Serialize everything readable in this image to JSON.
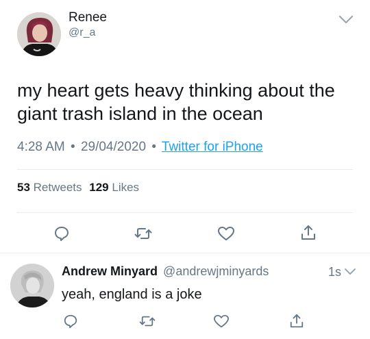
{
  "tweet": {
    "author": {
      "name": "Renee",
      "handle": "@r_a"
    },
    "text": "my heart gets heavy thinking about the giant trash island in the ocean",
    "time": "4:28 AM",
    "date": "29/04/2020",
    "source": "Twitter for iPhone",
    "separator": "•",
    "stats": {
      "retweets_count": "53",
      "retweets_label": "Retweets",
      "likes_count": "129",
      "likes_label": "Likes"
    }
  },
  "reply": {
    "author": {
      "name": "Andrew Minyard",
      "handle": "@andrewjminyards"
    },
    "age": "1s",
    "text": "yeah, england is a joke"
  },
  "icons": {
    "reply": "reply-icon",
    "retweet": "retweet-icon",
    "like": "heart-icon",
    "share": "share-icon",
    "menu": "chevron-down-icon"
  },
  "colors": {
    "text": "#14171a",
    "muted": "#657786",
    "link": "#1da1f2",
    "divider": "#e6ecf0"
  }
}
